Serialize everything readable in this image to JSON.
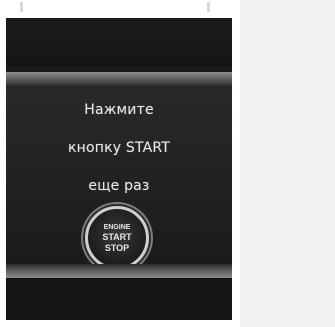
{
  "message": {
    "line1": "Нажмите",
    "line2": "кнопку START",
    "line3": "еще раз"
  },
  "start_button": {
    "line1": "ENGINE",
    "line2": "START",
    "line3": "STOP"
  },
  "colors": {
    "screen_background": "#1b1919",
    "text": "#e6e6e6",
    "page_background": "#f3f3f3"
  }
}
